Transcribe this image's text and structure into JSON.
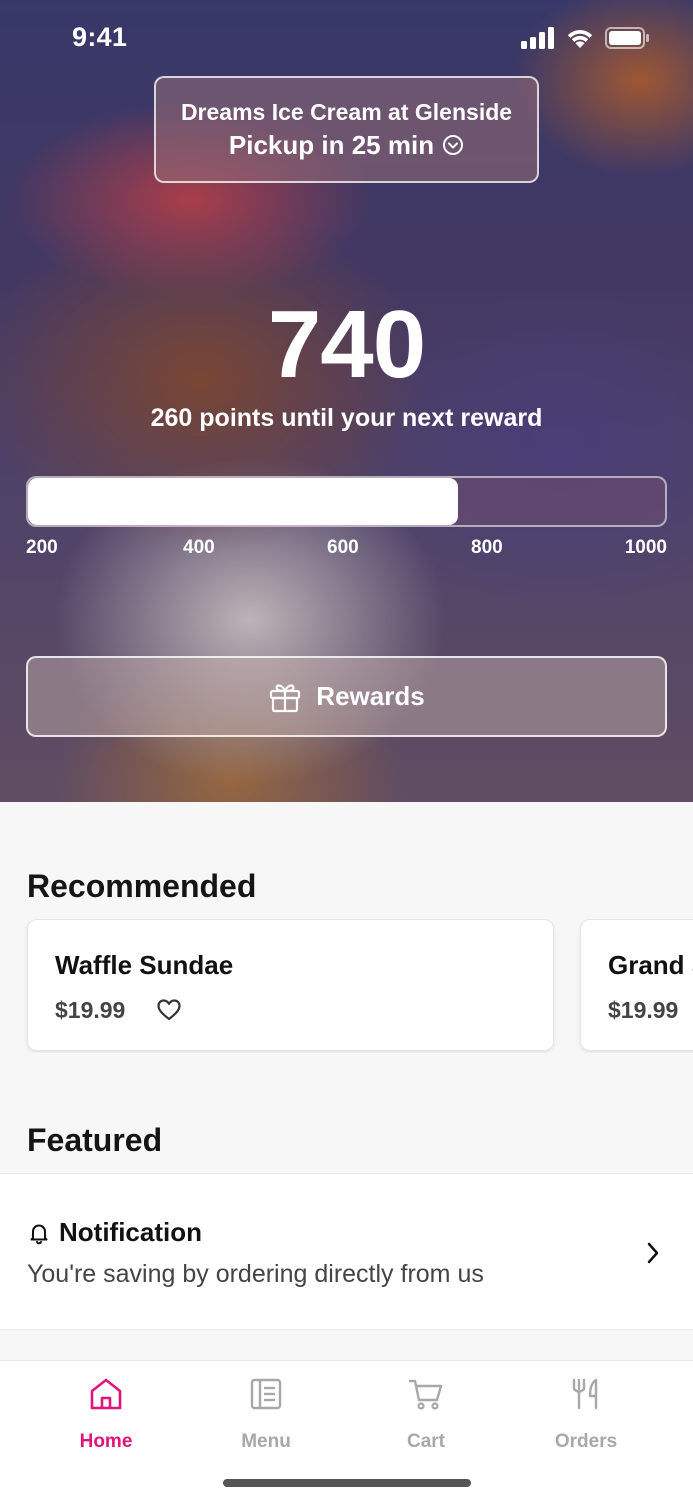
{
  "status_bar": {
    "time": "9:41"
  },
  "store": {
    "name": "Dreams Ice Cream at Glenside",
    "pickup": "Pickup in 25 min"
  },
  "rewards": {
    "points": "740",
    "subtitle": "260 points until your next reward",
    "progress_value": 740,
    "progress_range": [
      200,
      1000
    ],
    "scale_labels": [
      "200",
      "400",
      "600",
      "800",
      "1000"
    ],
    "button_label": "Rewards"
  },
  "recommended": {
    "title": "Recommended",
    "items": [
      {
        "name": "Waffle Sundae",
        "price": "$19.99"
      },
      {
        "name": "Grand S",
        "price": "$19.99"
      }
    ]
  },
  "featured": {
    "title": "Featured",
    "notification": {
      "title": "Notification",
      "message": "You're saving by ordering directly from us"
    }
  },
  "tabs": [
    {
      "label": "Home",
      "icon": "home-icon",
      "active": true
    },
    {
      "label": "Menu",
      "icon": "menu-icon",
      "active": false
    },
    {
      "label": "Cart",
      "icon": "cart-icon",
      "active": false
    },
    {
      "label": "Orders",
      "icon": "orders-icon",
      "active": false
    }
  ],
  "colors": {
    "accent": "#e0157a",
    "inactive": "#a8a8a8"
  }
}
